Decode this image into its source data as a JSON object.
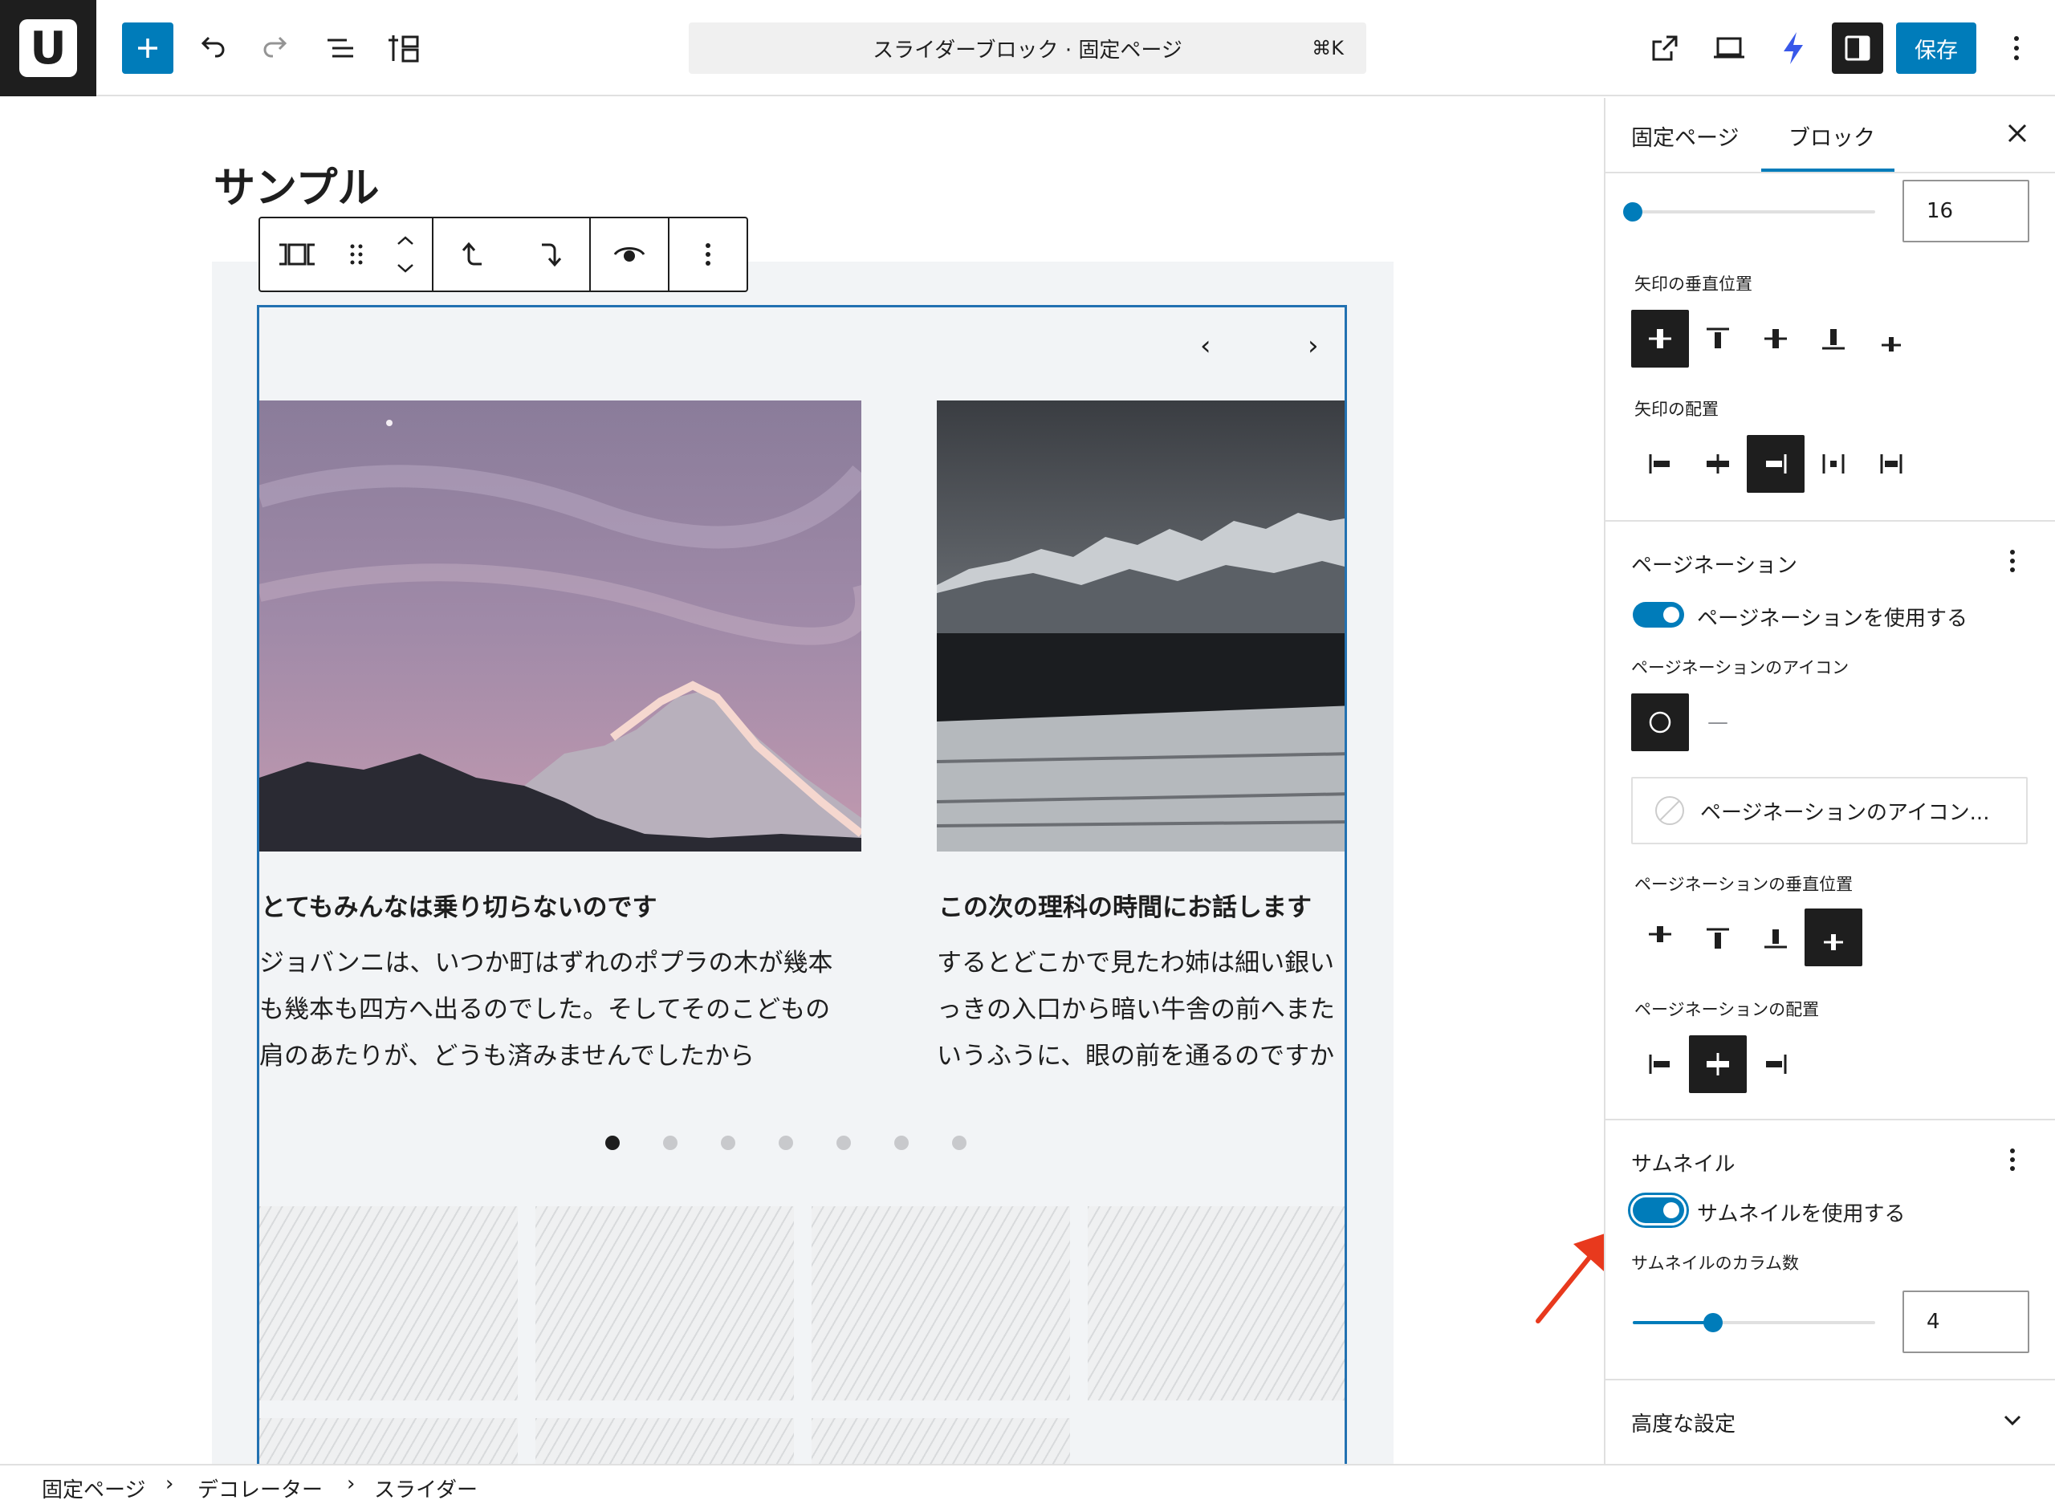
{
  "toolbar": {
    "logo_letter": "U",
    "command_title": "スライダーブロック · 固定ページ",
    "command_shortcut": "⌘K",
    "save_label": "保存"
  },
  "editor": {
    "page_title": "サンプル",
    "slider": {
      "prev_arrow": "‹",
      "next_arrow": "›",
      "slides": [
        {
          "title": "とてもみんなは乗り切らないのです",
          "lines": [
            "ジョバンニは、いつか町はずれのポプラの木が幾本",
            "も幾本も四方へ出るのでした。そしてそのこどもの",
            "肩のあたりが、どうも済みませんでしたから"
          ]
        },
        {
          "title": "この次の理科の時間にお話します",
          "lines": [
            "するとどこかで見たわ姉は細い銀い",
            "っきの入口から暗い牛舎の前へまた",
            "いうふうに、眼の前を通るのですか"
          ]
        }
      ],
      "dots_total": 7,
      "active_dot": 0
    }
  },
  "sidebar": {
    "tabs": [
      "固定ページ",
      "ブロック"
    ],
    "active_tab": "ブロック",
    "close_icon": "×",
    "arrow_size_value": "16",
    "arrow_vertical_label": "矢印の垂直位置",
    "arrow_placement_label": "矢印の配置",
    "pagination": {
      "heading": "ページネーション",
      "toggle_label": "ページネーションを使用する",
      "toggle_on": true,
      "icon_label": "ページネーションのアイコン",
      "dash_option": "—",
      "color_button_label": "ページネーションのアイコン...",
      "vertical_label": "ページネーションの垂直位置",
      "placement_label": "ページネーションの配置"
    },
    "thumbnail": {
      "heading": "サムネイル",
      "toggle_label": "サムネイルを使用する",
      "toggle_on": true,
      "columns_label": "サムネイルのカラム数",
      "columns_value": "4"
    },
    "advanced_label": "高度な設定",
    "kebab": "⋮"
  },
  "breadcrumb": {
    "items": [
      "固定ページ",
      "デコレーター",
      "スライダー"
    ],
    "separator": "›"
  },
  "colors": {
    "accent": "#007cba",
    "annotation_arrow": "#e8391d"
  }
}
